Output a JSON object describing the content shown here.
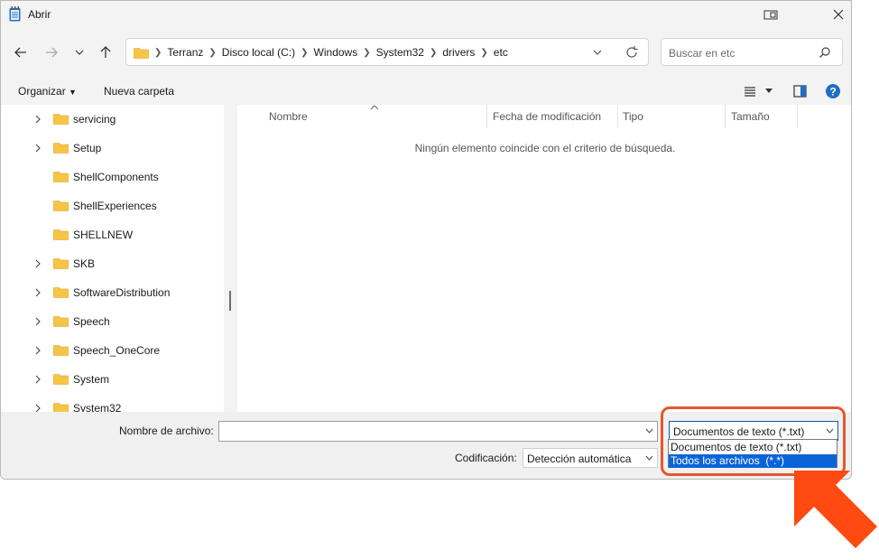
{
  "window": {
    "title": "Abrir"
  },
  "breadcrumb": [
    "Terranz",
    "Disco local (C:)",
    "Windows",
    "System32",
    "drivers",
    "etc"
  ],
  "search": {
    "placeholder": "Buscar en etc"
  },
  "toolbar": {
    "organize_label": "Organizar",
    "new_folder_label": "Nueva carpeta"
  },
  "tree": {
    "items": [
      {
        "label": "servicing",
        "expandable": true
      },
      {
        "label": "Setup",
        "expandable": true
      },
      {
        "label": "ShellComponents",
        "expandable": false
      },
      {
        "label": "ShellExperiences",
        "expandable": false
      },
      {
        "label": "SHELLNEW",
        "expandable": false
      },
      {
        "label": "SKB",
        "expandable": true
      },
      {
        "label": "SoftwareDistribution",
        "expandable": true
      },
      {
        "label": "Speech",
        "expandable": true
      },
      {
        "label": "Speech_OneCore",
        "expandable": true
      },
      {
        "label": "System",
        "expandable": true
      },
      {
        "label": "System32",
        "expandable": true
      }
    ]
  },
  "columns": [
    "Nombre",
    "Fecha de modificación",
    "Tipo",
    "Tamaño"
  ],
  "empty_message": "Ningún elemento coincide con el criterio de búsqueda.",
  "filename": {
    "label": "Nombre de archivo:",
    "value": ""
  },
  "encoding": {
    "label": "Codificación:",
    "value": "Detección automática"
  },
  "filetype": {
    "selected": "Documentos de texto (*.txt)",
    "options": [
      "Documentos de texto (*.txt)",
      "Todos los archivos  (*.*)"
    ],
    "highlighted_index": 1
  },
  "colors": {
    "accent": "#0a64d8",
    "annotation": "#e4572e",
    "annotation_arrow": "#ff4a12",
    "folder": "#f7c545"
  }
}
